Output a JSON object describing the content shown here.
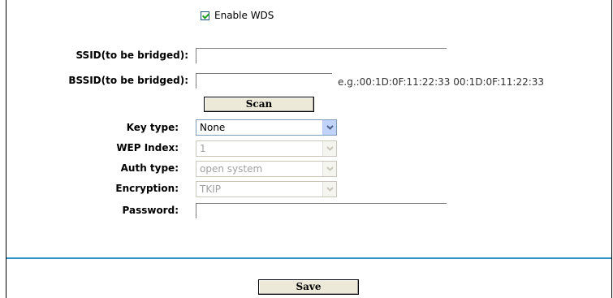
{
  "wds": {
    "enable_label": "Enable WDS",
    "checked": true
  },
  "fields": {
    "ssid": {
      "label": "SSID(to be bridged):",
      "value": ""
    },
    "bssid": {
      "label": "BSSID(to be bridged):",
      "value": "",
      "hint": "e.g.:00:1D:0F:11:22:33 00:1D:0F:11:22:33"
    },
    "scan_label": "Scan",
    "key_type": {
      "label": "Key type:",
      "selected": "None"
    },
    "wep_index": {
      "label": "WEP Index:",
      "selected": "1"
    },
    "auth_type": {
      "label": "Auth type:",
      "selected": "open system"
    },
    "encryption": {
      "label": "Encryption:",
      "selected": "TKIP"
    },
    "password": {
      "label": "Password:",
      "value": ""
    }
  },
  "save_label": "Save",
  "colors": {
    "divider": "#3192c9",
    "select_arrow": "#c1d3fb",
    "checkmark": "#21a121"
  }
}
